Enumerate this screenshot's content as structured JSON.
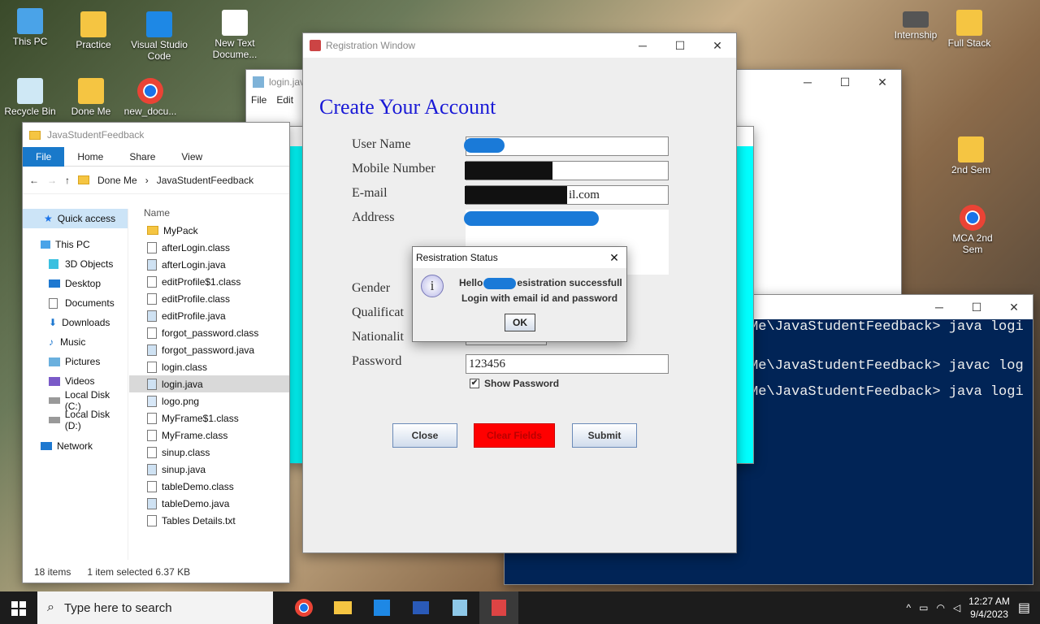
{
  "desktop_left": [
    {
      "label": "This PC"
    },
    {
      "label": "Practice"
    },
    {
      "label": "Visual Studio Code"
    },
    {
      "label": "New Text Docume..."
    },
    {
      "label": "Recycle Bin"
    },
    {
      "label": "Done Me"
    },
    {
      "label": "new_docu..."
    }
  ],
  "desktop_right": [
    {
      "label": "Internship"
    },
    {
      "label": "Full Stack"
    },
    {
      "label": "2nd Sem"
    },
    {
      "label": "MCA 2nd Sem"
    }
  ],
  "notepad": {
    "title": "login.java",
    "menu_file": "File",
    "menu_edit": "Edit"
  },
  "explorer": {
    "title": "JavaStudentFeedback",
    "tabs": [
      "File",
      "Home",
      "Share",
      "View"
    ],
    "crumb1": "Done Me",
    "crumb2": "JavaStudentFeedback",
    "column": "Name",
    "nav": [
      "Quick access",
      "This PC",
      "3D Objects",
      "Desktop",
      "Documents",
      "Downloads",
      "Music",
      "Pictures",
      "Videos",
      "Local Disk (C:)",
      "Local Disk (D:)",
      "Network"
    ],
    "files": [
      "MyPack",
      "afterLogin.class",
      "afterLogin.java",
      "editProfile$1.class",
      "editProfile.class",
      "editProfile.java",
      "forgot_password.class",
      "forgot_password.java",
      "login.class",
      "login.java",
      "logo.png",
      "MyFrame$1.class",
      "MyFrame.class",
      "sinup.class",
      "sinup.java",
      "tableDemo.class",
      "tableDemo.java",
      "Tables Details.txt"
    ],
    "item_count": "18 items",
    "selection": "1 item selected  6.37 KB"
  },
  "reg": {
    "window_title": "Registration Window",
    "heading": "Create Your Account",
    "label_user": "User Name",
    "label_mobile": "Mobile Number",
    "label_email": "E-mail",
    "label_address": "Address",
    "label_gender": "Gender",
    "label_qual": "Qualificat",
    "label_nat": "Nationalit",
    "label_password": "Password",
    "email_value": "il.com",
    "password_value": "123456",
    "show_password": "Show Password",
    "btn_close": "Close",
    "btn_clear": "Clear Fields",
    "btn_submit": "Submit"
  },
  "dialog": {
    "title": "Resistration Status",
    "line1_a": "Hello",
    "line1_b": "esistration successfull",
    "line2": "Login with email id and password",
    "ok": "OK"
  },
  "ps": {
    "lines": [
      "Me\\JavaStudentFeedback> java logi",
      "Me\\JavaStudentFeedback> javac log",
      "Me\\JavaStudentFeedback> java logi"
    ]
  },
  "taskbar": {
    "search_placeholder": "Type here to search",
    "time": "12:27 AM",
    "date": "9/4/2023"
  }
}
